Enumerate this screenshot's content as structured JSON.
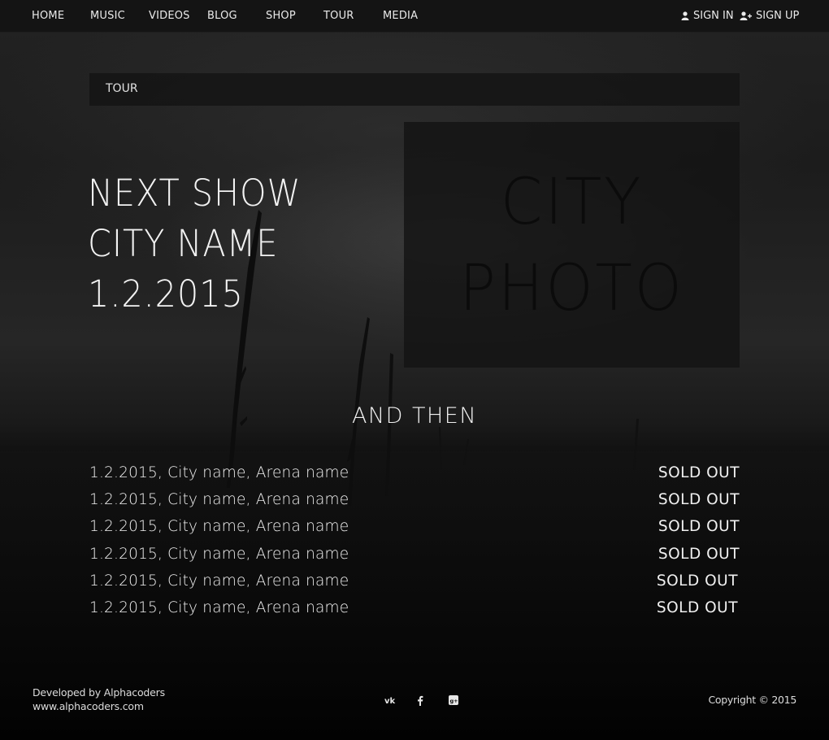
{
  "nav": {
    "items": [
      {
        "label": "HOME"
      },
      {
        "label": "MUSIC"
      },
      {
        "label": "VIDEOS"
      },
      {
        "label": "BLOG"
      },
      {
        "label": "SHOP"
      },
      {
        "label": "TOUR"
      },
      {
        "label": "MEDIA"
      }
    ],
    "sign_in": "SIGN IN",
    "sign_up": "SIGN UP"
  },
  "breadcrumb": "TOUR",
  "hero": {
    "line1": "NEXT SHOW",
    "line2": "CITY NAME",
    "line3": "1.2.2015",
    "photo_line1": "CITY",
    "photo_line2": "PHOTO"
  },
  "and_then": "AND THEN",
  "shows": [
    {
      "info": "1.2.2015, City name, Arena name",
      "status": "SOLD OUT"
    },
    {
      "info": "1.2.2015, City name, Arena name",
      "status": "SOLD OUT"
    },
    {
      "info": "1.2.2015, City name, Arena name",
      "status": "SOLD OUT"
    },
    {
      "info": "1.2.2015, City name, Arena name",
      "status": "SOLD OUT"
    },
    {
      "info": "1.2.2015, City name, Arena name",
      "status": "SOLD OUT"
    },
    {
      "info": "1.2.2015, City name, Arena name",
      "status": "SOLD OUT"
    }
  ],
  "footer": {
    "developed_by": "Developed by Alphacoders",
    "site": "www.alphacoders.com",
    "copyright": "Copyright © 2015",
    "social": [
      "vk-icon",
      "facebook-icon",
      "google-plus-icon"
    ]
  },
  "colors": {
    "background": "#0a0a0a",
    "nav_bar": "#141414",
    "text": "#f0f0f0",
    "photo_box": "#141414"
  }
}
